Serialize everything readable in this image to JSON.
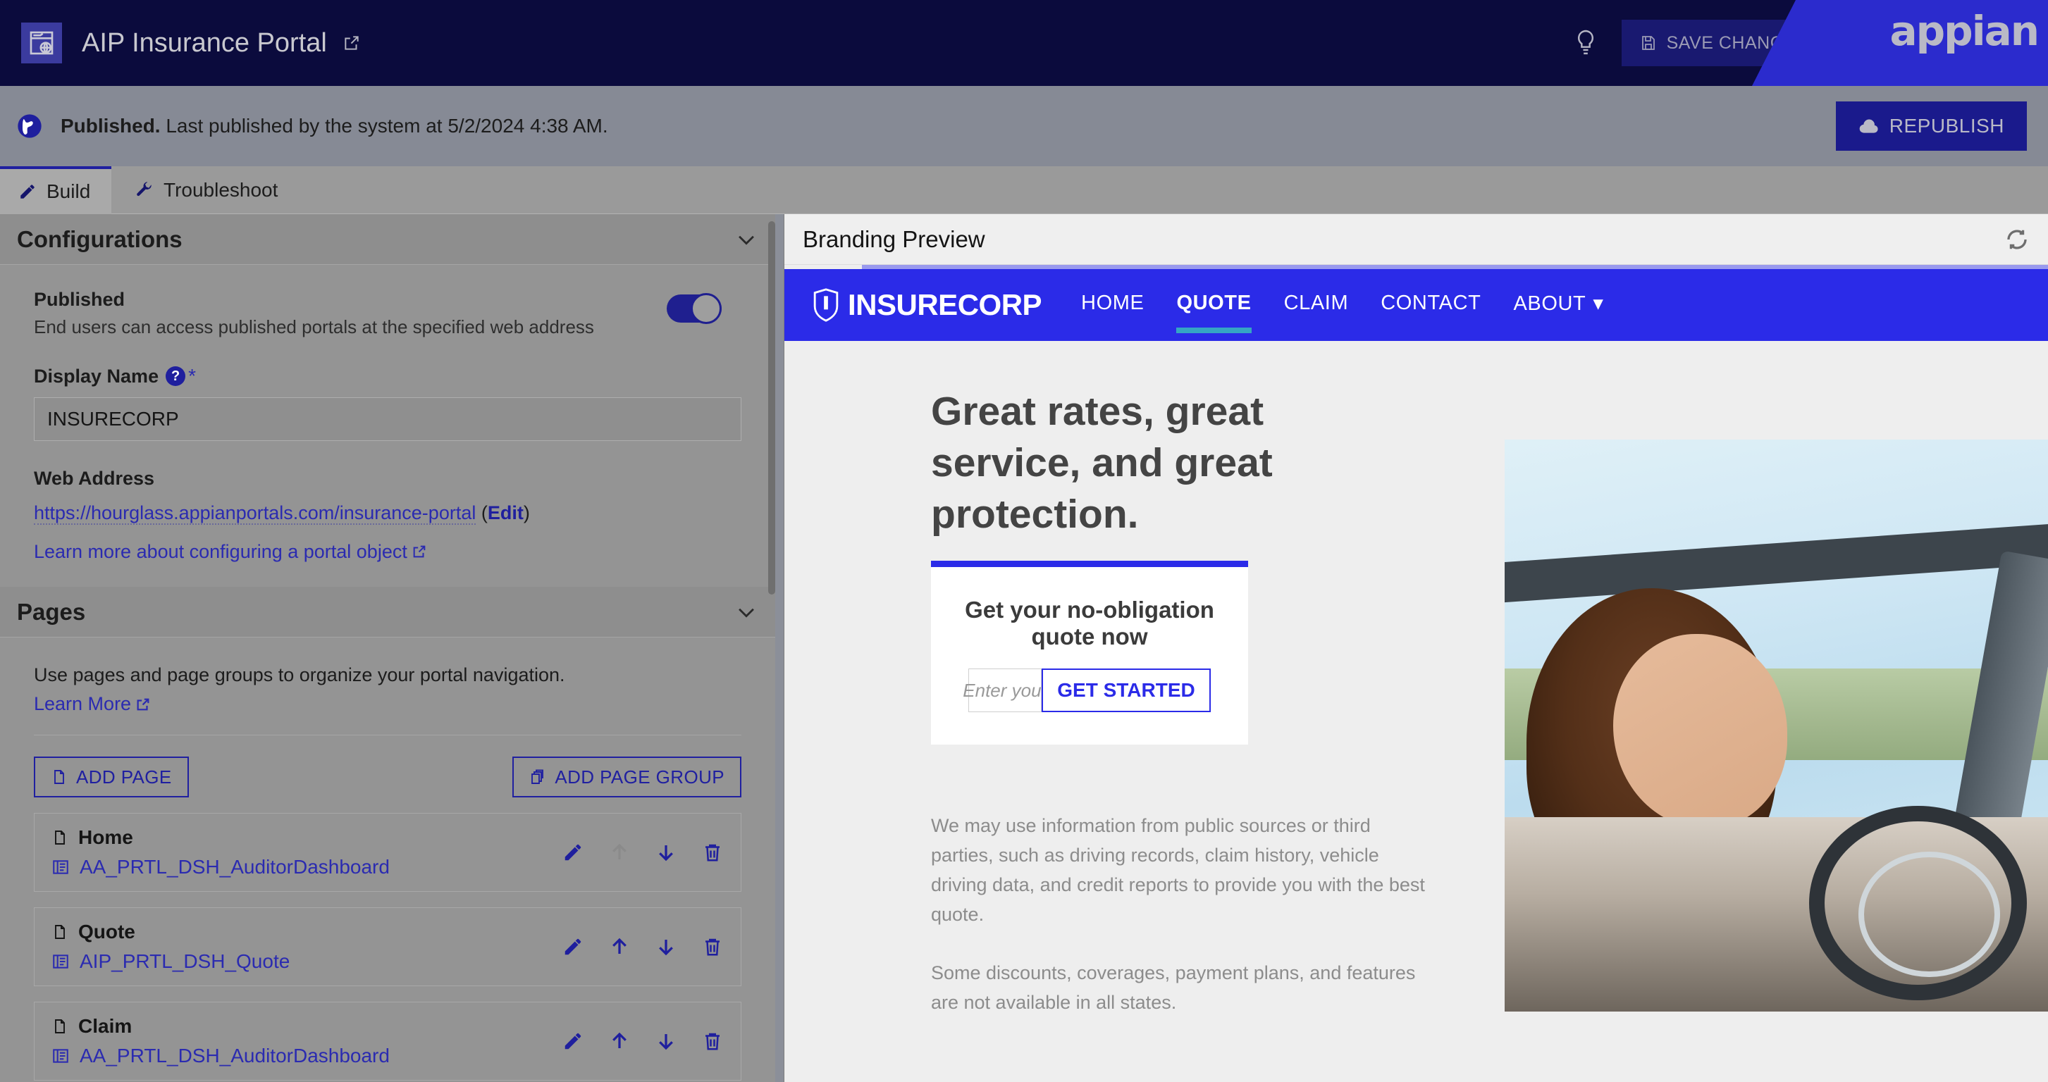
{
  "topbar": {
    "app_icon": "portal-icon",
    "title": "AIP Insurance Portal",
    "open_new_tab_icon": "external-link-icon",
    "hint_icon": "lightbulb-icon",
    "save_label": "SAVE CHANGES",
    "save_icon": "save-disk-icon",
    "search_icon": "search-icon",
    "settings_icon": "gear-icon",
    "apps_icon": "grid-apps-icon",
    "avatar": "user-avatar",
    "brand": "appian"
  },
  "publishbar": {
    "globe_icon": "globe-icon",
    "status_bold": "Published.",
    "status_rest": " Last published by the system at 5/2/2024 4:38 AM.",
    "republish_label": "REPUBLISH",
    "republish_icon": "cloud-upload-icon"
  },
  "tabs": [
    {
      "label": "Build",
      "icon": "pencil-icon",
      "active": true
    },
    {
      "label": "Troubleshoot",
      "icon": "wrench-icon",
      "active": false
    }
  ],
  "configurations": {
    "section_title": "Configurations",
    "collapse_icon": "chevron-down-icon",
    "published": {
      "label": "Published",
      "description": "End users can access published portals at the specified web address",
      "toggle_on": true
    },
    "display_name": {
      "label": "Display Name",
      "help_icon": "question-mark-icon",
      "required_marker": "*",
      "value": "INSURECORP"
    },
    "web_address": {
      "label": "Web Address",
      "url": "https://hourglass.appianportals.com/insurance-portal",
      "edit_prefix": " (",
      "edit_label": "Edit",
      "edit_suffix": ")"
    },
    "learn_more_link": "Learn more about configuring a portal object",
    "learn_more_icon": "external-link-icon"
  },
  "pages": {
    "section_title": "Pages",
    "collapse_icon": "chevron-down-icon",
    "description": "Use pages and page groups to organize your portal navigation.",
    "learn_more": "Learn More",
    "learn_more_icon": "external-link-icon",
    "add_page_label": "ADD PAGE",
    "add_page_icon": "page-icon",
    "add_page_group_label": "ADD PAGE GROUP",
    "add_page_group_icon": "pages-stack-icon",
    "items": [
      {
        "title": "Home",
        "object": "AA_PRTL_DSH_AuditorDashboard",
        "move_up_disabled": true
      },
      {
        "title": "Quote",
        "object": "AIP_PRTL_DSH_Quote",
        "move_up_disabled": false
      },
      {
        "title": "Claim",
        "object": "AA_PRTL_DSH_AuditorDashboard",
        "move_up_disabled": false
      }
    ],
    "row_actions": {
      "edit_icon": "pencil-icon",
      "move_up_icon": "arrow-up-icon",
      "move_down_icon": "arrow-down-icon",
      "delete_icon": "trash-icon"
    }
  },
  "preview": {
    "header_title": "Branding Preview",
    "refresh_icon": "refresh-icon",
    "site": {
      "logo_icon": "shield-icon",
      "logo_text": "INSURECORP",
      "nav": [
        {
          "label": "HOME",
          "active": false,
          "caret": false
        },
        {
          "label": "QUOTE",
          "active": true,
          "caret": false
        },
        {
          "label": "CLAIM",
          "active": false,
          "caret": false
        },
        {
          "label": "CONTACT",
          "active": false,
          "caret": false
        },
        {
          "label": "ABOUT",
          "active": false,
          "caret": true
        }
      ],
      "hero_heading": "Great rates, great service, and great protection.",
      "quote_card": {
        "title": "Get your no-obligation quote now",
        "input_placeholder": "Enter your",
        "input_value": "",
        "button_label": "GET STARTED"
      },
      "disclaimer_1": "We may use information from public sources or third parties, such as driving records, claim history, vehicle driving data, and credit reports to provide you with the best quote.",
      "disclaimer_2": "Some discounts, coverages, payment plans, and features are not available in all states.",
      "hero_image": "woman-driving-convertible-photo"
    }
  },
  "colors": {
    "header_bg": "#0b0b3d",
    "appian_blue": "#2b2bcd",
    "publish_bar": "#868a95",
    "panel_bg": "#949494",
    "accent_link": "#2b2bb0",
    "brand_blue": "#2b2be8",
    "active_underline": "#35a5c4"
  }
}
